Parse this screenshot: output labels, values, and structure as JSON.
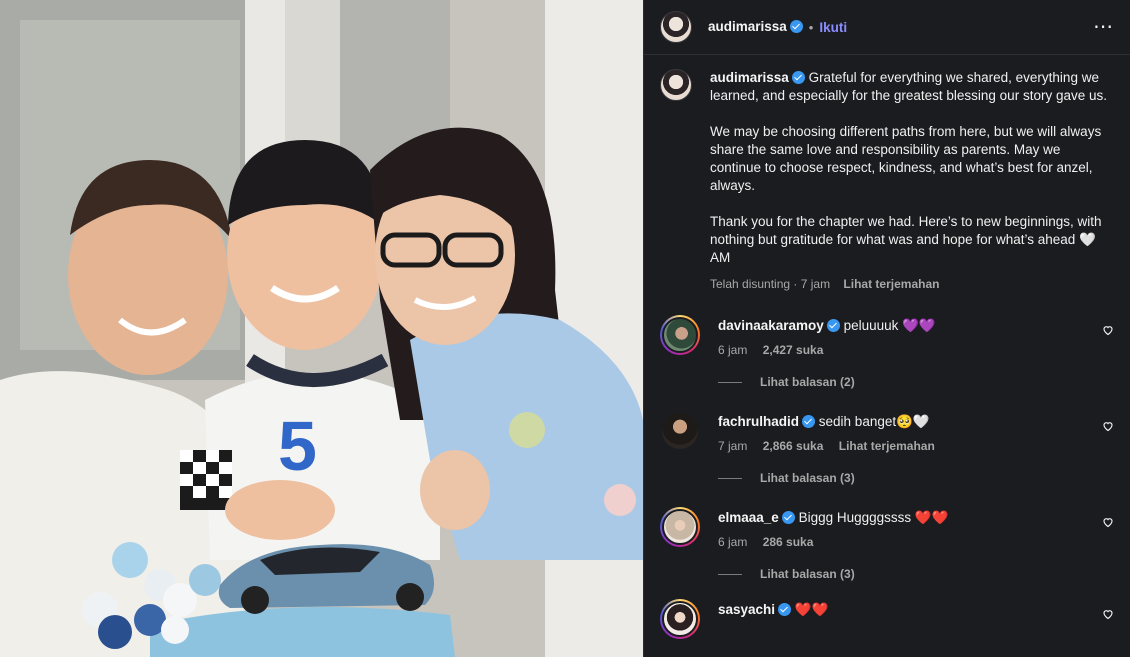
{
  "post": {
    "author": "audimarissa",
    "follow_label": "Ikuti",
    "dot": "•",
    "more_label": "⋯",
    "caption": {
      "author": "audimarissa",
      "paragraph_1": "Grateful for everything we shared, everything we learned, and especially for the greatest blessing our story gave us.",
      "paragraph_2": "We may be choosing different paths from here, but we will always share the same love and responsibility as parents. May we continue to choose respect, kindness, and what’s best for anzel, always.",
      "paragraph_3": "Thank you for the chapter we had. Here’s to new beginnings, with nothing but gratitude for what was and hope for what’s ahead 🤍 AM",
      "edited": "Telah disunting · 7 jam",
      "translate": "Lihat terjemahan"
    }
  },
  "comments": [
    {
      "username": "davinaakaramoy",
      "text": "peluuuuk 💜💜",
      "time": "6 jam",
      "likes": "2,427 suka",
      "translate": "",
      "replies": "Lihat balasan (2)"
    },
    {
      "username": "fachrulhadid",
      "text": "sedih banget🥺🤍",
      "time": "7 jam",
      "likes": "2,866 suka",
      "translate": "Lihat terjemahan",
      "replies": "Lihat balasan (3)"
    },
    {
      "username": "elmaaa_e",
      "text": "Biggg Huggggssss ❤️❤️",
      "time": "6 jam",
      "likes": "286 suka",
      "translate": "",
      "replies": "Lihat balasan (3)"
    },
    {
      "username": "sasyachi",
      "text": "❤️❤️"
    }
  ],
  "photo": {
    "jersey_number": "5"
  },
  "colors": {
    "panel_bg": "#1b1c20",
    "follow": "#8a8dff",
    "verified": "#3897f0"
  }
}
